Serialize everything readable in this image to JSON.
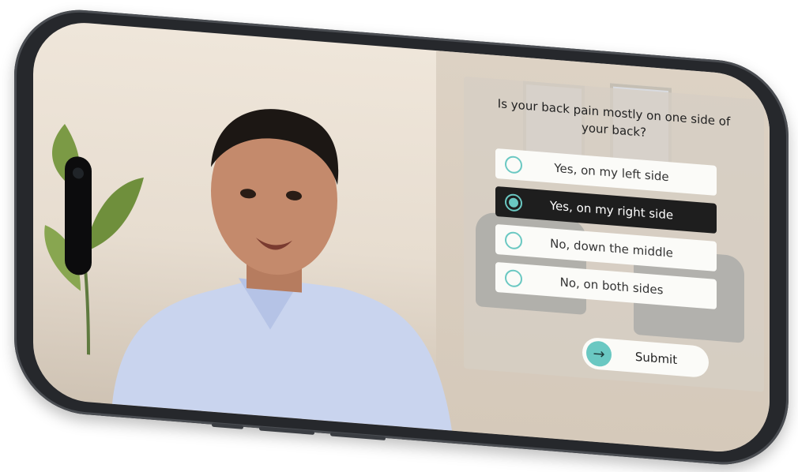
{
  "quiz": {
    "question": "Is your back pain mostly on one side of your back?",
    "options": [
      {
        "label": "Yes, on my left side",
        "selected": false
      },
      {
        "label": "Yes, on my right side",
        "selected": true
      },
      {
        "label": "No, down the middle",
        "selected": false
      },
      {
        "label": "No, on both sides",
        "selected": false
      }
    ],
    "submit_label": "Submit"
  },
  "icons": {
    "submit": "arrow-right-icon"
  },
  "colors": {
    "accent": "#6ac8c2",
    "selected_bg": "#1e1e1e",
    "option_bg": "#fbfbf8"
  }
}
